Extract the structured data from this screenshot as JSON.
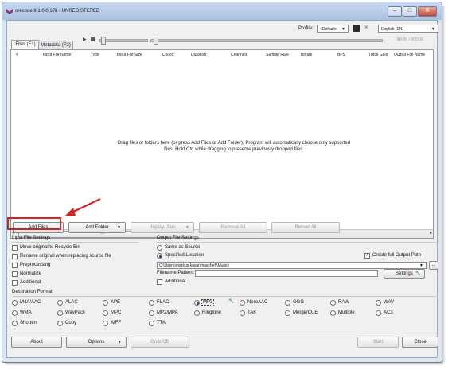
{
  "window": {
    "title": "orecode II 1.0.0.178 - UNREGISTERED"
  },
  "toolbar": {
    "profile_label": "Profile:",
    "profile_value": "<Default>",
    "language_value": "English (EN)",
    "time_readout": "000:00 / 000:00"
  },
  "tabs": [
    {
      "label": "Files (F1)"
    },
    {
      "label": "Metadata (F2)"
    }
  ],
  "file_list": {
    "columns": [
      "#",
      "Input File Name",
      "Type",
      "Input File Size",
      "Codec",
      "Duration",
      "Channels",
      "Sample Rate",
      "Bitrate",
      "BPS",
      "Track Gain",
      "Output File Name"
    ],
    "drop_hint": "Drag files or folders here (or press Add Files or Add Folder). Program will automatically choose only supported files. Hold Ctrl while dragging to preserve previously dropped files.",
    "scroll_marker": "III"
  },
  "actions": {
    "add_files": "Add Files",
    "add_folder": "Add Folder",
    "replay_gain": "Replay Gain",
    "remove_all": "Remove All",
    "reload_all": "Reload All"
  },
  "input_settings": {
    "title": "Input File Settings",
    "options": [
      {
        "label": "Move original to Recycle Bin",
        "checked": false
      },
      {
        "label": "Rename original when replacing source file",
        "checked": false
      },
      {
        "label": "Preprocessing",
        "checked": false
      },
      {
        "label": "Normalize",
        "checked": false
      },
      {
        "label": "Additional",
        "checked": false
      }
    ]
  },
  "output_settings": {
    "title": "Output File Settings",
    "same_as_source": "Same as Source",
    "specified_location": "Specified Location",
    "create_full_path": "Create full Output Path",
    "path": "C:\\Users\\markus.kasanmascheff\\Music\\",
    "browse": "...",
    "filename_pattern_label": "Filename Pattern:",
    "settings_button": "Settings",
    "additional": "Additional"
  },
  "destination": {
    "title": "Destination Format",
    "formats": [
      [
        "M4A/AAC",
        "ALAC",
        "APE",
        "FLAC",
        "MP3",
        "NeroAAC",
        "OGG",
        "RAW",
        "WAV"
      ],
      [
        "WMA",
        "WavPack",
        "MPC",
        "MP2/MPA",
        "Ringtone",
        "TAK",
        "Merge/CUE",
        "Multiple",
        "AC3"
      ],
      [
        "Shorten",
        "Copy",
        "AIFF",
        "TTA"
      ]
    ],
    "selected": "MP3"
  },
  "bottom": {
    "about": "About",
    "options": "Options",
    "grab_cd": "Grab CD",
    "start": "Start",
    "close": "Close"
  },
  "colors": {
    "highlight": "#d32323",
    "accent": "#1f3f8f"
  }
}
